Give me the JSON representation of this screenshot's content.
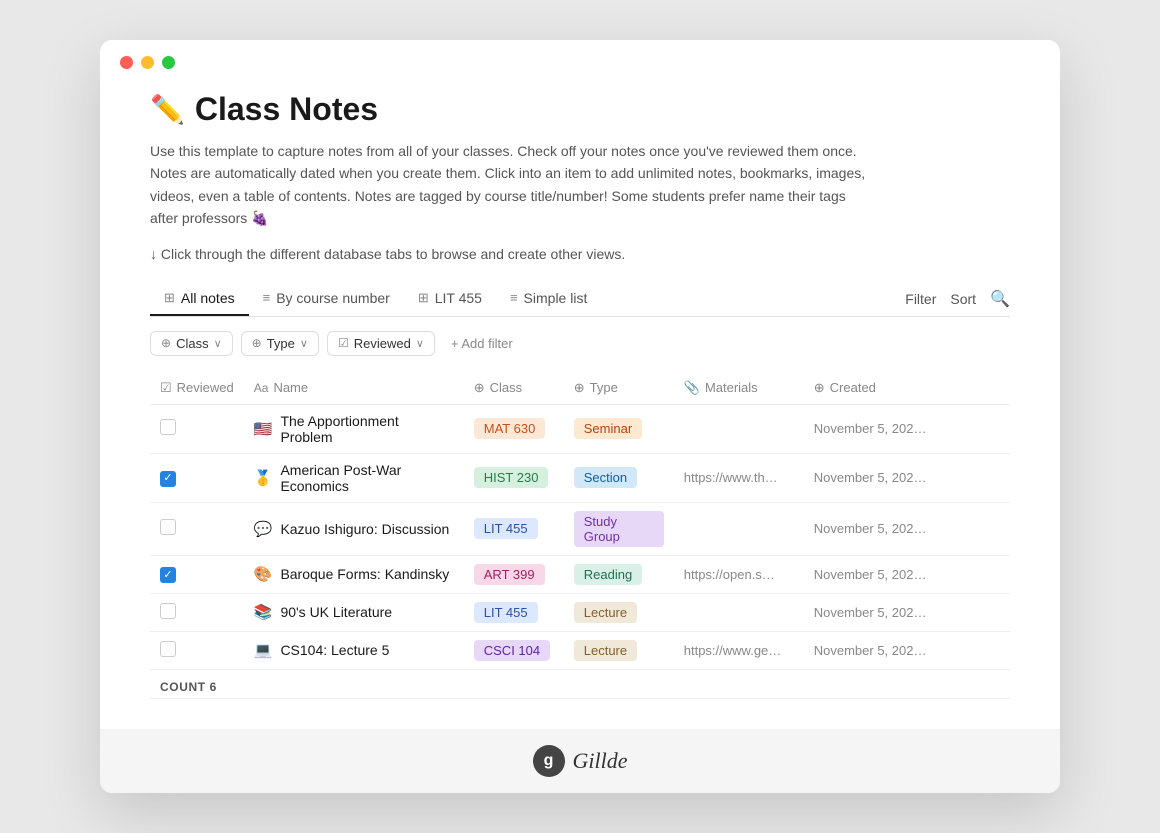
{
  "window": {
    "title": "Class Notes"
  },
  "header": {
    "emoji": "✏️",
    "title": "Class Notes",
    "description": "Use this template to capture notes from all of your classes. Check off your notes once you've reviewed them once. Notes are automatically dated when you create them. Click into an item to add unlimited notes, bookmarks, images, videos, even a table of contents. Notes are tagged by course title/number!  Some students prefer name their tags after professors 🍇",
    "hint": "↓ Click through the different database tabs to browse and create other views."
  },
  "tabs": [
    {
      "label": "All notes",
      "icon": "⊞",
      "active": true
    },
    {
      "label": "By course number",
      "icon": "≡",
      "active": false
    },
    {
      "label": "LIT 455",
      "icon": "⊞",
      "active": false
    },
    {
      "label": "Simple list",
      "icon": "≡",
      "active": false
    }
  ],
  "actions": {
    "filter": "Filter",
    "sort": "Sort"
  },
  "filters": [
    {
      "icon": "⊕",
      "label": "Class"
    },
    {
      "icon": "⊕",
      "label": "Type"
    },
    {
      "icon": "☑",
      "label": "Reviewed"
    }
  ],
  "add_filter_label": "+ Add filter",
  "table": {
    "columns": [
      {
        "icon": "☑",
        "label": "Reviewed"
      },
      {
        "icon": "Aa",
        "label": "Name"
      },
      {
        "icon": "⊕",
        "label": "Class"
      },
      {
        "icon": "⊕",
        "label": "Type"
      },
      {
        "icon": "📎",
        "label": "Materials"
      },
      {
        "icon": "⊕",
        "label": "Created"
      }
    ],
    "rows": [
      {
        "reviewed": false,
        "emoji": "🇺🇸",
        "name": "The Apportionment Problem",
        "class_label": "MAT 630",
        "class_style": "tag-mat630",
        "type_label": "Seminar",
        "type_style": "type-seminar",
        "materials": "",
        "created": "November 5, 202…"
      },
      {
        "reviewed": true,
        "emoji": "🥇",
        "name": "American Post-War Economics",
        "class_label": "HIST 230",
        "class_style": "tag-hist230",
        "type_label": "Section",
        "type_style": "type-section",
        "materials": "https://www.th…",
        "created": "November 5, 202…"
      },
      {
        "reviewed": false,
        "emoji": "💬",
        "name": "Kazuo Ishiguro: Discussion",
        "class_label": "LIT 455",
        "class_style": "tag-lit455",
        "type_label": "Study Group",
        "type_style": "type-studygroup",
        "materials": "",
        "created": "November 5, 202…"
      },
      {
        "reviewed": true,
        "emoji": "🎨",
        "name": "Baroque Forms: Kandinsky",
        "class_label": "ART 399",
        "class_style": "tag-art399",
        "type_label": "Reading",
        "type_style": "type-reading",
        "materials": "https://open.s…",
        "created": "November 5, 202…"
      },
      {
        "reviewed": false,
        "emoji": "📚",
        "name": "90's UK Literature",
        "class_label": "LIT 455",
        "class_style": "tag-lit455",
        "type_label": "Lecture",
        "type_style": "type-lecture",
        "materials": "",
        "created": "November 5, 202…"
      },
      {
        "reviewed": false,
        "emoji": "💻",
        "name": "CS104: Lecture 5",
        "class_label": "CSCI 104",
        "class_style": "tag-csci104",
        "type_label": "Lecture",
        "type_style": "type-lecture",
        "materials": "https://www.ge…",
        "created": "November 5, 202…"
      }
    ],
    "count_label": "COUNT",
    "count_value": "6"
  },
  "footer": {
    "brand": "Gillde",
    "logo_char": "g"
  }
}
